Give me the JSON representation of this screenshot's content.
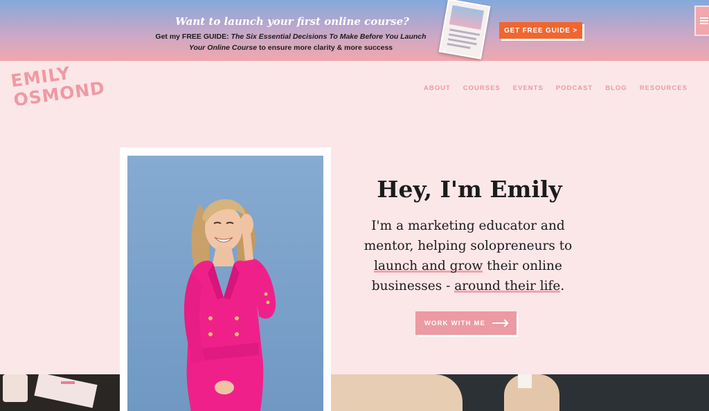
{
  "banner": {
    "headline": "Want to launch your first online course?",
    "sub_prefix": "Get my FREE GUIDE: ",
    "sub_title": "The Six Essential Decisions To Make Before You Launch Your Online Course",
    "sub_suffix": " to ensure more clarity & more success",
    "cta_label": "GET FREE GUIDE >",
    "cover_icon": "guide-book-cover"
  },
  "logo": {
    "line1": "EMILY",
    "line2": "OSMOND"
  },
  "nav": {
    "items": [
      {
        "label": "ABOUT"
      },
      {
        "label": "COURSES"
      },
      {
        "label": "EVENTS"
      },
      {
        "label": "PODCAST"
      },
      {
        "label": "BLOG"
      },
      {
        "label": "RESOURCES"
      }
    ]
  },
  "hero": {
    "title": "Hey, I'm Emily",
    "body_part1": "I'm a marketing educator and mentor,  helping solopreneurs to ",
    "highlight1": "launch and grow",
    "body_part2": " their online businesses - ",
    "highlight2": "around their life",
    "body_end": ".",
    "cta_label": "WORK WITH ME"
  },
  "colors": {
    "page_bg": "#fbe6e8",
    "accent_pink": "#ec9aa3",
    "banner_cta": "#f0662f",
    "dress_pink": "#f0208a"
  }
}
